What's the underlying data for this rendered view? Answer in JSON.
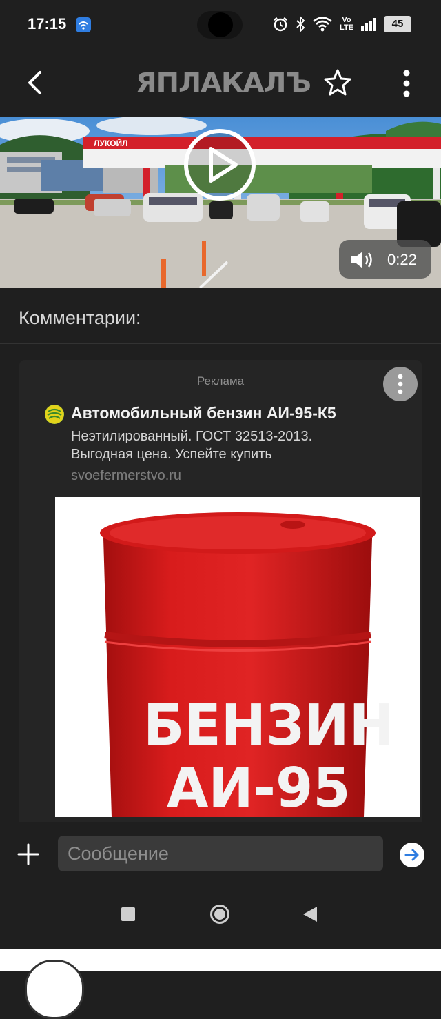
{
  "status_bar": {
    "time": "17:15",
    "volte_top": "Vo",
    "volte_bottom": "LTE",
    "battery": "45"
  },
  "header": {
    "logo": "ЯПЛАКАЛЪ"
  },
  "video": {
    "duration": "0:22",
    "station_sign": "ЛУКОЙЛ"
  },
  "comments": {
    "title": "Комментарии:"
  },
  "ad": {
    "label": "Реклама",
    "title": "Автомобильный бензин АИ-95-К5",
    "desc_line1": "Неэтилированный. ГОСТ 32513-2013.",
    "desc_line2": "Выгодная цена. Успейте купить",
    "url": "svoefermerstvo.ru",
    "barrel_line1": "БЕНЗИН",
    "barrel_line2": "АИ-95"
  },
  "composer": {
    "placeholder": "Сообщение"
  },
  "colors": {
    "background": "#1f1f1f",
    "accent_blue": "#2f7de1",
    "barrel_red": "#d81c1c",
    "lukoil_red": "#d3202a"
  }
}
